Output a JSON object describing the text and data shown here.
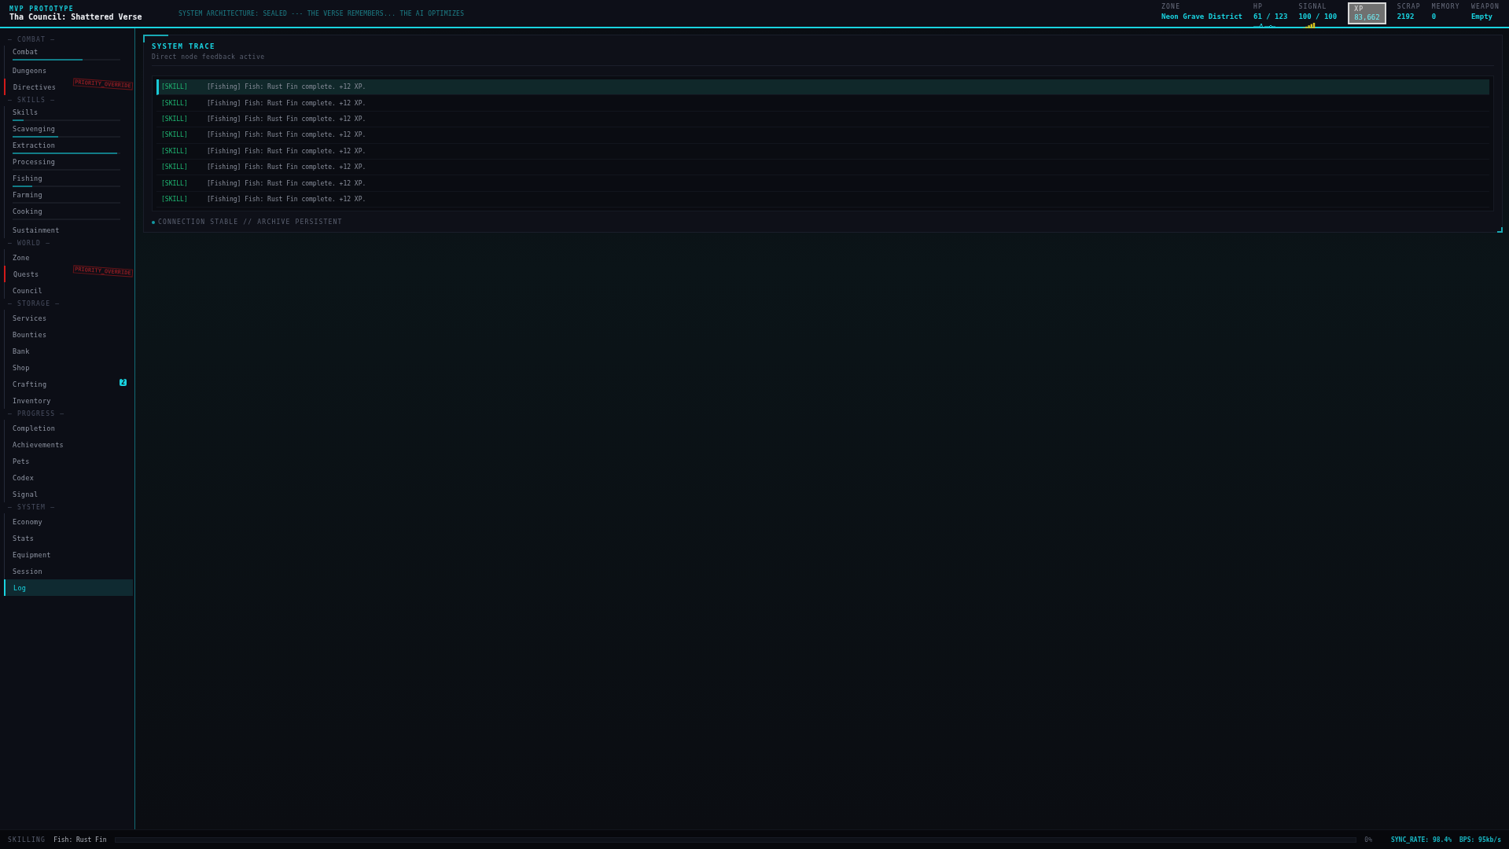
{
  "header": {
    "eyebrow": "MVP PROTOTYPE",
    "title": "Tha Council: Shattered Verse",
    "ticker": "SYSTEM ARCHITECTURE: SEALED --- THE VERSE REMEMBERS... THE AI OPTIMIZES",
    "stats": [
      {
        "label": "ZONE",
        "value": "Neon Grave District",
        "kind": "text",
        "selected": false
      },
      {
        "label": "HP",
        "value": "61 / 123",
        "kind": "pulse",
        "selected": false
      },
      {
        "label": "SIGNAL",
        "value": "100 / 100",
        "kind": "signal",
        "selected": false
      },
      {
        "label": "XP",
        "value": "83,662",
        "kind": "text",
        "selected": true
      },
      {
        "label": "SCRAP",
        "value": "2192",
        "kind": "text",
        "selected": false
      },
      {
        "label": "MEMORY",
        "value": "0",
        "kind": "text",
        "selected": false
      },
      {
        "label": "WEAPON",
        "value": "Empty",
        "kind": "text",
        "selected": false
      }
    ]
  },
  "sidebar": {
    "sections": [
      {
        "title": "— COMBAT —",
        "items": [
          {
            "label": "Combat",
            "kind": "progress",
            "level": 0.65,
            "selected": false
          },
          {
            "label": "Dungeons",
            "kind": "plain",
            "selected": false
          },
          {
            "label": "Directives",
            "kind": "alert",
            "stamp": "PRIORITY_OVERRIDE",
            "selected": false
          }
        ]
      },
      {
        "title": "— SKILLS —",
        "items": [
          {
            "label": "Skills",
            "kind": "progress",
            "level": 0.1,
            "selected": false
          },
          {
            "label": "Scavenging",
            "kind": "progress",
            "level": 0.42,
            "selected": false
          },
          {
            "label": "Extraction",
            "kind": "progress",
            "level": 0.97,
            "selected": false
          },
          {
            "label": "Processing",
            "kind": "progress",
            "level": 0,
            "selected": false
          },
          {
            "label": "Fishing",
            "kind": "progress",
            "level": 0.18,
            "selected": false
          },
          {
            "label": "Farming",
            "kind": "progress",
            "level": 0,
            "selected": false
          },
          {
            "label": "Cooking",
            "kind": "progress",
            "level": 0,
            "selected": false
          },
          {
            "label": "Sustainment",
            "kind": "plain",
            "selected": false
          }
        ]
      },
      {
        "title": "— WORLD —",
        "items": [
          {
            "label": "Zone",
            "kind": "plain",
            "selected": false
          },
          {
            "label": "Quests",
            "kind": "alert",
            "stamp": "PRIORITY_OVERRIDE",
            "selected": false
          },
          {
            "label": "Council",
            "kind": "plain",
            "selected": false
          }
        ]
      },
      {
        "title": "— STORAGE —",
        "items": [
          {
            "label": "Services",
            "kind": "plain",
            "selected": false
          },
          {
            "label": "Bounties",
            "kind": "plain",
            "selected": false
          },
          {
            "label": "Bank",
            "kind": "plain",
            "selected": false
          },
          {
            "label": "Shop",
            "kind": "plain",
            "selected": false
          },
          {
            "label": "Crafting",
            "kind": "count",
            "badge": "2",
            "selected": false
          },
          {
            "label": "Inventory",
            "kind": "plain",
            "selected": false
          }
        ]
      },
      {
        "title": "— PROGRESS —",
        "items": [
          {
            "label": "Completion",
            "kind": "plain",
            "selected": false
          },
          {
            "label": "Achievements",
            "kind": "plain",
            "selected": false
          },
          {
            "label": "Pets",
            "kind": "plain",
            "selected": false
          },
          {
            "label": "Codex",
            "kind": "plain",
            "selected": false
          },
          {
            "label": "Signal",
            "kind": "plain",
            "selected": false
          }
        ]
      },
      {
        "title": "— SYSTEM —",
        "items": [
          {
            "label": "Economy",
            "kind": "plain",
            "selected": false
          },
          {
            "label": "Stats",
            "kind": "plain",
            "selected": false
          },
          {
            "label": "Equipment",
            "kind": "plain",
            "selected": false
          },
          {
            "label": "Session",
            "kind": "plain",
            "selected": false
          },
          {
            "label": "Log",
            "kind": "plain",
            "selected": true
          }
        ]
      }
    ]
  },
  "panel": {
    "title": "SYSTEM TRACE",
    "subtitle": "Direct node feedback active",
    "log": [
      {
        "tag": "[SKILL]",
        "message": "[Fishing] Fish: Rust Fin complete. +12 XP.",
        "selected": true
      },
      {
        "tag": "[SKILL]",
        "message": "[Fishing] Fish: Rust Fin complete. +12 XP.",
        "selected": false
      },
      {
        "tag": "[SKILL]",
        "message": "[Fishing] Fish: Rust Fin complete. +12 XP.",
        "selected": false
      },
      {
        "tag": "[SKILL]",
        "message": "[Fishing] Fish: Rust Fin complete. +12 XP.",
        "selected": false
      },
      {
        "tag": "[SKILL]",
        "message": "[Fishing] Fish: Rust Fin complete. +12 XP.",
        "selected": false
      },
      {
        "tag": "[SKILL]",
        "message": "[Fishing] Fish: Rust Fin complete. +12 XP.",
        "selected": false
      },
      {
        "tag": "[SKILL]",
        "message": "[Fishing] Fish: Rust Fin complete. +12 XP.",
        "selected": false
      },
      {
        "tag": "[SKILL]",
        "message": "[Fishing] Fish: Rust Fin complete. +12 XP.",
        "selected": false
      }
    ],
    "status": "CONNECTION STABLE // ARCHIVE PERSISTENT"
  },
  "footer": {
    "label": "SKILLING",
    "activity": "Fish: Rust Fin",
    "level": 0,
    "percent": "0%",
    "sync": "SYNC_RATE: 98.4%",
    "bps": "BPS: 95kb/s"
  }
}
